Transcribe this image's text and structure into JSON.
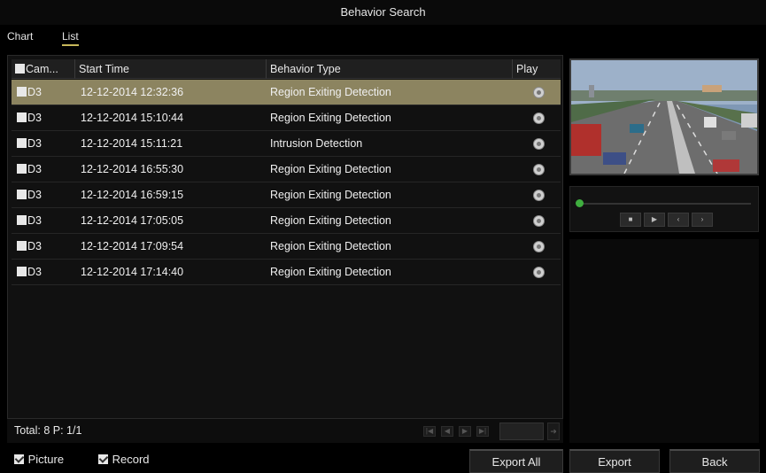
{
  "window": {
    "title": "Behavior Search"
  },
  "tabs": [
    {
      "label": "Chart",
      "active": false
    },
    {
      "label": "List",
      "active": true
    }
  ],
  "table": {
    "headers": {
      "camera": "Cam...",
      "start_time": "Start Time",
      "behavior_type": "Behavior Type",
      "play": "Play"
    },
    "rows": [
      {
        "camera": "D3",
        "start_time": "12-12-2014 12:32:36",
        "behavior_type": "Region Exiting Detection",
        "selected": true
      },
      {
        "camera": "D3",
        "start_time": "12-12-2014 15:10:44",
        "behavior_type": "Region Exiting Detection",
        "selected": false
      },
      {
        "camera": "D3",
        "start_time": "12-12-2014 15:11:21",
        "behavior_type": "Intrusion Detection",
        "selected": false
      },
      {
        "camera": "D3",
        "start_time": "12-12-2014 16:55:30",
        "behavior_type": "Region Exiting Detection",
        "selected": false
      },
      {
        "camera": "D3",
        "start_time": "12-12-2014 16:59:15",
        "behavior_type": "Region Exiting Detection",
        "selected": false
      },
      {
        "camera": "D3",
        "start_time": "12-12-2014 17:05:05",
        "behavior_type": "Region Exiting Detection",
        "selected": false
      },
      {
        "camera": "D3",
        "start_time": "12-12-2014 17:09:54",
        "behavior_type": "Region Exiting Detection",
        "selected": false
      },
      {
        "camera": "D3",
        "start_time": "12-12-2014 17:14:40",
        "behavior_type": "Region Exiting Detection",
        "selected": false
      }
    ]
  },
  "footer": {
    "total": "Total: 8  P: 1/1"
  },
  "options": {
    "picture_label": "Picture",
    "picture_checked": true,
    "record_label": "Record",
    "record_checked": true
  },
  "buttons": {
    "export_all": "Export All",
    "export": "Export",
    "back": "Back"
  },
  "colors": {
    "selected_row": "#8c8460",
    "tab_underline": "#c8b85a",
    "timeline_dot": "#3fae3f"
  },
  "icons": {
    "play": "play-circle-icon",
    "checkbox": "checkbox-icon"
  }
}
